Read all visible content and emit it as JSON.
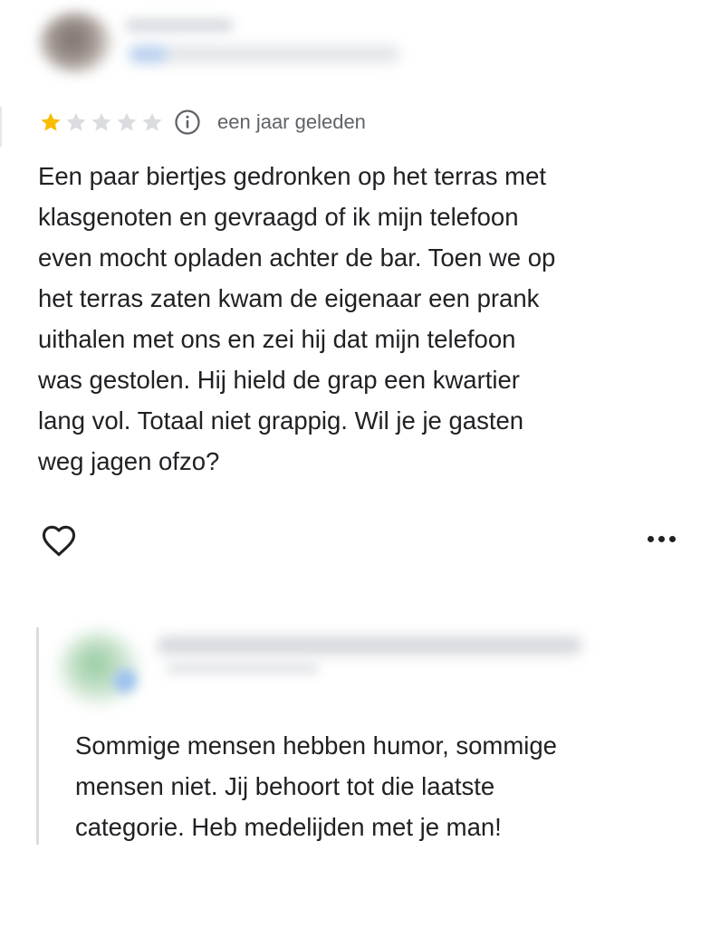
{
  "review": {
    "rating": 1,
    "max_rating": 5,
    "time_ago": "een jaar geleden",
    "text": "Een paar biertjes gedronken op het terras met\nklasgenoten en gevraagd of ik mijn telefoon\neven mocht opladen achter de bar. Toen we op\nhet terras zaten kwam de eigenaar een prank\nuithalen met ons en zei hij dat mijn telefoon\nwas gestolen. Hij hield de grap een kwartier\nlang vol. Totaal niet grappig. Wil je je gasten\nweg jagen ofzo?"
  },
  "reply": {
    "text": "Sommige mensen hebben humor, sommige\nmensen niet. Jij behoort tot die laatste\ncategorie. Heb medelijden met je man!"
  },
  "icons": {
    "star_filled": "star-filled-icon",
    "star_empty": "star-empty-icon",
    "info": "info-icon",
    "like": "heart-outline-icon",
    "more": "more-horizontal-icon"
  },
  "colors": {
    "star_filled": "#fbbc04",
    "star_empty": "#dadce0",
    "text_primary": "#202124",
    "text_secondary": "#5f6368",
    "reply_border": "#dadce0"
  }
}
